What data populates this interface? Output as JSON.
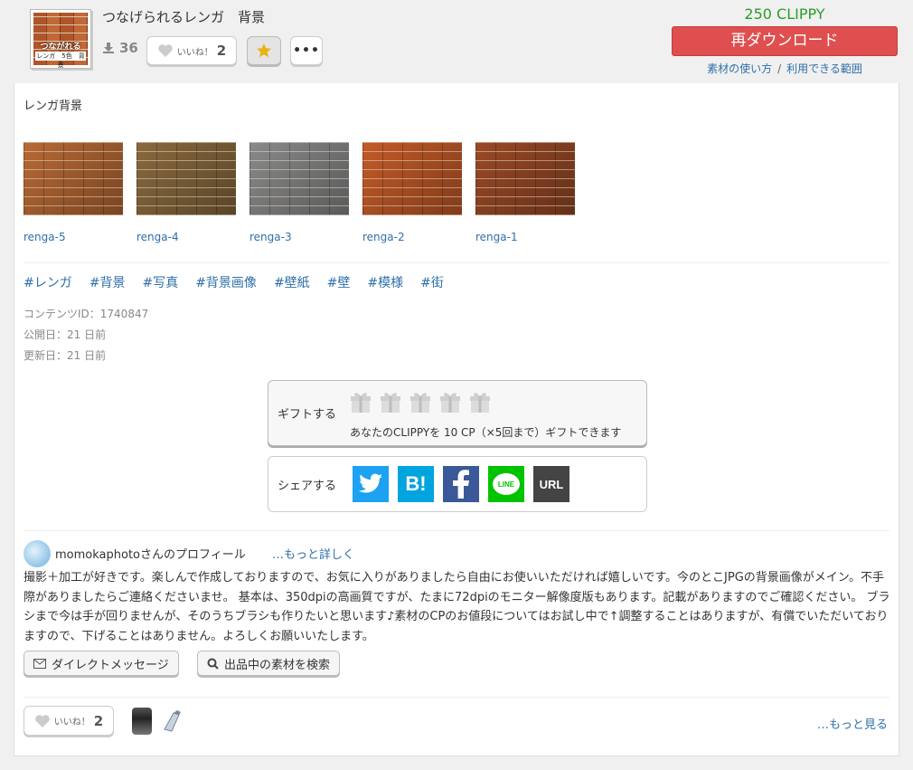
{
  "header": {
    "title": "つなげられるレンガ　背景",
    "thumb_label": "つながれる",
    "thumb_sub": "レンガ　5色　背景",
    "download_count": "36",
    "like_label": "いいね！",
    "like_count": "2",
    "more_label": "•••",
    "price": "250 CLIPPY",
    "redownload_label": "再ダウンロード",
    "help_link_1": "素材の使い方",
    "help_sep": "/",
    "help_link_2": "利用できる範囲"
  },
  "description": "レンガ背景",
  "samples": [
    {
      "name": "renga-5",
      "tone": "#b86a35"
    },
    {
      "name": "renga-4",
      "tone": "#8a6a3e"
    },
    {
      "name": "renga-3",
      "tone": "#8a8a8a"
    },
    {
      "name": "renga-2",
      "tone": "#c45b28"
    },
    {
      "name": "renga-1",
      "tone": "#9a4a26"
    }
  ],
  "tags": [
    "#レンガ",
    "#背景",
    "#写真",
    "#背景画像",
    "#壁紙",
    "#壁",
    "#模様",
    "#街"
  ],
  "meta": {
    "content_id": "コンテンツID：1740847",
    "published": "公開日：21 日前",
    "updated": "更新日：21 日前"
  },
  "gift": {
    "label": "ギフトする",
    "note": "あなたのCLIPPYを 10 CP（×5回まで）ギフトできます",
    "count": 5
  },
  "share": {
    "label": "シェアする",
    "hatena": "B!",
    "line": "LINE",
    "url": "URL"
  },
  "profile": {
    "name": "momokaphotoさんのプロフィール",
    "more": "…もっと詳しく",
    "text": "撮影＋加工が好きです。楽しんで作成しておりますので、お気に入りがありましたら自由にお使いいただければ嬉しいです。今のとこJPGの背景画像がメイン。不手際がありましたらご連絡くださいませ。 基本は、350dpiの高画質ですが、たまに72dpiのモニター解像度版もあります。記載がありますのでご確認ください。 ブラシまで今は手が回りませんが、そのうちブラシも作りたいと思います♪素材のCPのお値段についてはお試し中で↑調整することはありますが、有償でいただいておりますので、下げることはありません。よろしくお願いいたします。",
    "dm_label": "ダイレクトメッセージ",
    "search_label": "出品中の素材を検索"
  },
  "footer": {
    "like_label": "いいね！",
    "like_count": "2",
    "see_more": "…もっと見る"
  },
  "colors": {
    "accent_red": "#df4f4f",
    "price_green": "#2a9d2a",
    "link_blue": "#2f6faa",
    "twitter": "#1da1f2",
    "hatena": "#00a4de",
    "facebook": "#3b5998",
    "line": "#00c300",
    "url": "#444444"
  }
}
